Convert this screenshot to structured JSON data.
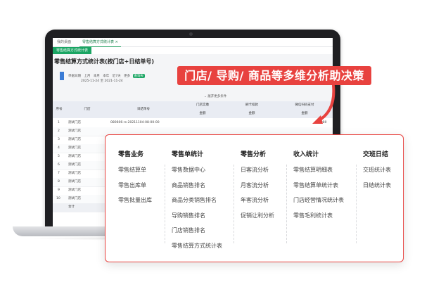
{
  "banner": {
    "text": "门店/ 导购/ 商品等多维分析助决策"
  },
  "screen": {
    "tabs": [
      "我的桌面",
      "零售结算方式统计表"
    ],
    "tab_close": "×",
    "active_tab": "零售结算方式统计表",
    "page_title": "零售结算方式统计表(按门店+日结单号)",
    "filter": {
      "label": "单据日期",
      "links": [
        "上月",
        "本月",
        "本年",
        "近7天",
        "更多"
      ],
      "pill": "查询天",
      "date_range": "2025-11-24 至 2021-11-24",
      "store_label": "门店",
      "doc_label": "日结单号",
      "more": "展开更多条件"
    },
    "table": {
      "group_headers": [
        "门店实缴",
        "刷卡扣款",
        "微信扫码支付"
      ],
      "headers": [
        "序号",
        "门店",
        "日结单号",
        "金额",
        "金额",
        "金额"
      ],
      "first_row_doc": "080606-rs-20211104-08-00-00",
      "first_row_amount": "8080",
      "rows": [
        {
          "no": "1",
          "store": "测试门店"
        },
        {
          "no": "2",
          "store": "测试门店"
        },
        {
          "no": "3",
          "store": "测试门店"
        },
        {
          "no": "4",
          "store": "测试门店"
        },
        {
          "no": "5",
          "store": "测试门店"
        },
        {
          "no": "6",
          "store": "测试门店"
        },
        {
          "no": "7",
          "store": "测试门店"
        },
        {
          "no": "8",
          "store": "测试门店"
        },
        {
          "no": "9",
          "store": "测试门店"
        },
        {
          "no": "10",
          "store": "测试门店"
        }
      ],
      "total_label": "合计"
    }
  },
  "menu": {
    "columns": [
      {
        "title": "零售业务",
        "items": [
          "零售结算单",
          "零售出库单",
          "零售批量出库"
        ]
      },
      {
        "title": "零售单统计",
        "items": [
          "零售数据中心",
          "商品销售排名",
          "商品分类销售排名",
          "导购销售排名",
          "门店销售排名",
          "零售结算方式统计表"
        ]
      },
      {
        "title": "零售分析",
        "items": [
          "日客流分析",
          "月客流分析",
          "年客流分析",
          "促销让利分析"
        ]
      },
      {
        "title": "收入统计",
        "items": [
          "零售结算明细表",
          "零售结算单统计表",
          "门店经营情况统计表",
          "零售毛利统计表"
        ]
      },
      {
        "title": "交班日结",
        "items": [
          "交班统计表",
          "日结统计表"
        ]
      }
    ]
  },
  "colors": {
    "brand_green": "#1aa563",
    "accent_red": "#e8423f",
    "laptop_frame": "#1f1f22"
  }
}
